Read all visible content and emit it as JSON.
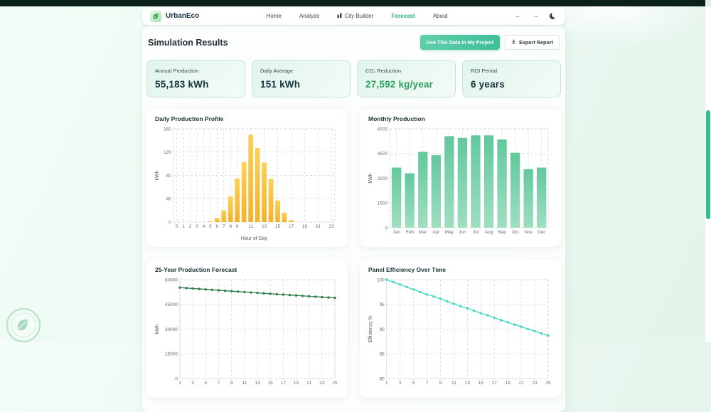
{
  "theme": {
    "accent": "#3fbf97",
    "top_bar": "#0c211b",
    "active_link": "#2aa98c"
  },
  "nav": {
    "brand": "UrbanEco",
    "items": [
      {
        "label": "Home",
        "active": false
      },
      {
        "label": "Analyze",
        "active": false
      },
      {
        "label": "City Builder",
        "active": false,
        "icon": "city-builder-icon"
      },
      {
        "label": "Forecast",
        "active": true
      },
      {
        "label": "About",
        "active": false
      }
    ],
    "controls": {
      "back": "←",
      "forward": "→",
      "theme_toggle": "moon-icon"
    }
  },
  "page": {
    "title": "Simulation Results",
    "actions": {
      "use_data_label": "Use This Data in My Project",
      "export_label": "Export Report"
    }
  },
  "stats": [
    {
      "label": "Annual Production",
      "value": "55,183 kWh"
    },
    {
      "label": "Daily Average",
      "value": "151 kWh"
    },
    {
      "label": "CO₂ Reduction",
      "value": "27,592 kg/year"
    },
    {
      "label": "ROI Period",
      "value": "6 years"
    }
  ],
  "chart_data": [
    {
      "type": "bar",
      "title": "Daily Production Profile",
      "xlabel": "Hour of Day",
      "ylabel": "kWh",
      "categories": [
        "0",
        "1",
        "2",
        "3",
        "4",
        "5",
        "6",
        "7",
        "8",
        "9",
        "10",
        "11",
        "12",
        "13",
        "14",
        "15",
        "16",
        "17",
        "18",
        "19",
        "20",
        "21",
        "22",
        "23"
      ],
      "values": [
        0,
        0,
        0,
        0,
        0,
        1,
        7,
        20,
        44,
        75,
        103,
        150,
        127,
        102,
        74,
        37,
        16,
        3,
        0,
        0,
        0,
        0,
        0,
        0
      ],
      "ylim": [
        0,
        160
      ],
      "yticks": [
        0,
        40,
        80,
        120,
        160
      ],
      "xticks": [
        "0",
        "1",
        "2",
        "3",
        "4",
        "5",
        "6",
        "7",
        "8",
        "9",
        "11",
        "13",
        "15",
        "17",
        "19",
        "21",
        "23"
      ],
      "bar_colors": [
        "#fbd056",
        "#f3b32e"
      ],
      "grid": true,
      "legend": "none"
    },
    {
      "type": "bar",
      "title": "Monthly Production",
      "xlabel": "",
      "ylabel": "kWh",
      "categories": [
        "Jan",
        "Feb",
        "Mar",
        "Apr",
        "May",
        "Jun",
        "Jul",
        "Aug",
        "Sep",
        "Oct",
        "Nov",
        "Dec"
      ],
      "values": [
        3650,
        3300,
        4600,
        4400,
        5550,
        5450,
        5600,
        5600,
        5350,
        4550,
        3550,
        3650
      ],
      "ylim": [
        0,
        6000
      ],
      "yticks": [
        0,
        1500,
        3000,
        4500,
        6000
      ],
      "xticks": [
        "Jan",
        "Feb",
        "Mar",
        "Apr",
        "May",
        "Jun",
        "Jul",
        "Aug",
        "Sep",
        "Oct",
        "Nov",
        "Dec"
      ],
      "bar_colors": [
        "#62c89c",
        "#9fdfc0"
      ],
      "grid": true,
      "legend": "none"
    },
    {
      "type": "line",
      "title": "25-Year Production Forecast",
      "xlabel": "",
      "ylabel": "kWh",
      "x": [
        1,
        2,
        3,
        4,
        5,
        6,
        7,
        8,
        9,
        10,
        11,
        12,
        13,
        14,
        15,
        16,
        17,
        18,
        19,
        20,
        21,
        22,
        23,
        24,
        25
      ],
      "values": [
        55183,
        54907,
        54632,
        54359,
        54087,
        53817,
        53548,
        53280,
        53014,
        52749,
        52485,
        52223,
        51962,
        51702,
        51443,
        51186,
        50930,
        50675,
        50422,
        50170,
        49919,
        49669,
        49421,
        49174,
        48928
      ],
      "ylim": [
        0,
        60000
      ],
      "yticks": [
        0,
        15000,
        30000,
        45000,
        60000
      ],
      "xticks": [
        "1",
        "3",
        "5",
        "7",
        "9",
        "11",
        "13",
        "15",
        "17",
        "19",
        "21",
        "23",
        "25"
      ],
      "color": "#2e7d4f",
      "grid": true,
      "legend": "none"
    },
    {
      "type": "line",
      "title": "Panel Efficiency Over Time",
      "xlabel": "",
      "ylabel": "Efficiency %",
      "x": [
        1,
        2,
        3,
        4,
        5,
        6,
        7,
        8,
        9,
        10,
        11,
        12,
        13,
        14,
        15,
        16,
        17,
        18,
        19,
        20,
        21,
        22,
        23,
        24,
        25
      ],
      "values": [
        100,
        99.5,
        99,
        98.5,
        98,
        97.5,
        97,
        96.6,
        96.1,
        95.6,
        95.1,
        94.6,
        94.2,
        93.7,
        93.2,
        92.8,
        92.3,
        91.8,
        91.4,
        90.9,
        90.5,
        90,
        89.6,
        89.1,
        88.7
      ],
      "ylim": [
        80,
        100
      ],
      "yticks": [
        80,
        85,
        90,
        95,
        100
      ],
      "xticks": [
        "1",
        "3",
        "5",
        "7",
        "9",
        "11",
        "13",
        "15",
        "17",
        "19",
        "21",
        "23",
        "25"
      ],
      "color": "#45d6c2",
      "grid": true,
      "legend": "none"
    }
  ]
}
